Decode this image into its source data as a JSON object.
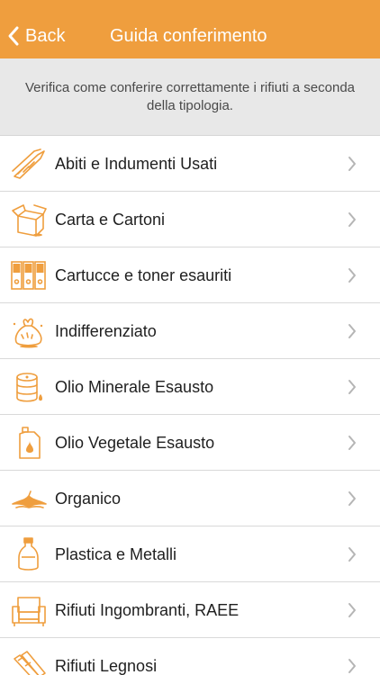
{
  "navbar": {
    "back_label": "Back",
    "title": "Guida conferimento",
    "background": "#EF9E3E"
  },
  "banner": {
    "text": "Verifica come conferire correttamente i rifiuti a seconda della tipologia."
  },
  "accent_color": "#EF9E3E",
  "items": [
    {
      "label": "Abiti e Indumenti Usati",
      "icon": "clothes-icon"
    },
    {
      "label": "Carta e Cartoni",
      "icon": "cardboard-box-icon"
    },
    {
      "label": "Cartucce e toner esauriti",
      "icon": "toner-cartridges-icon"
    },
    {
      "label": "Indifferenziato",
      "icon": "garbage-bag-icon"
    },
    {
      "label": "Olio Minerale Esausto",
      "icon": "oil-barrel-icon"
    },
    {
      "label": "Olio Vegetale Esausto",
      "icon": "oil-jerrycan-icon"
    },
    {
      "label": "Organico",
      "icon": "banana-peel-icon"
    },
    {
      "label": "Plastica e Metalli",
      "icon": "plastic-bottle-icon"
    },
    {
      "label": "Rifiuti Ingombranti, RAEE",
      "icon": "armchair-icon"
    },
    {
      "label": "Rifiuti Legnosi",
      "icon": "wood-planks-icon"
    }
  ]
}
